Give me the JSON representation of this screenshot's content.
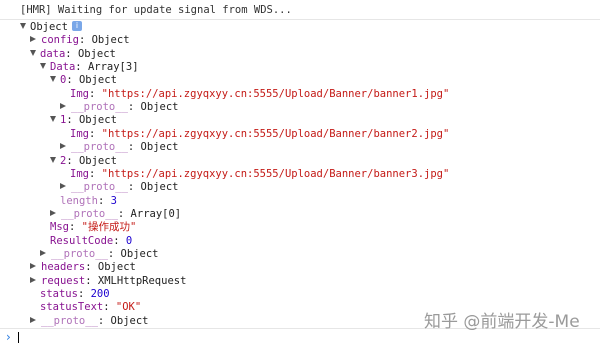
{
  "console": {
    "hmr_message": "[HMR] Waiting for update signal from WDS...",
    "rows": [
      {
        "indent": 0,
        "toggle": "down",
        "parts": [
          {
            "t": "Object",
            "c": "plain"
          }
        ],
        "info": "i"
      },
      {
        "indent": 1,
        "toggle": "right",
        "parts": [
          {
            "t": "config",
            "c": "key"
          },
          {
            "t": ": Object",
            "c": "plain"
          }
        ]
      },
      {
        "indent": 1,
        "toggle": "down",
        "parts": [
          {
            "t": "data",
            "c": "key"
          },
          {
            "t": ": Object",
            "c": "plain"
          }
        ]
      },
      {
        "indent": 2,
        "toggle": "down",
        "parts": [
          {
            "t": "Data",
            "c": "key"
          },
          {
            "t": ": Array[3]",
            "c": "plain"
          }
        ]
      },
      {
        "indent": 3,
        "toggle": "down",
        "parts": [
          {
            "t": "0",
            "c": "key"
          },
          {
            "t": ": Object",
            "c": "plain"
          }
        ]
      },
      {
        "indent": 4,
        "toggle": "none",
        "parts": [
          {
            "t": "Img",
            "c": "key"
          },
          {
            "t": ": ",
            "c": "plain"
          },
          {
            "t": "\"https://api.zgyqxyy.cn:5555/Upload/Banner/banner1.jpg\"",
            "c": "str"
          }
        ]
      },
      {
        "indent": 4,
        "toggle": "right",
        "parts": [
          {
            "t": "__proto__",
            "c": "key dim"
          },
          {
            "t": ": Object",
            "c": "plain"
          }
        ]
      },
      {
        "indent": 3,
        "toggle": "down",
        "parts": [
          {
            "t": "1",
            "c": "key"
          },
          {
            "t": ": Object",
            "c": "plain"
          }
        ]
      },
      {
        "indent": 4,
        "toggle": "none",
        "parts": [
          {
            "t": "Img",
            "c": "key"
          },
          {
            "t": ": ",
            "c": "plain"
          },
          {
            "t": "\"https://api.zgyqxyy.cn:5555/Upload/Banner/banner2.jpg\"",
            "c": "str"
          }
        ]
      },
      {
        "indent": 4,
        "toggle": "right",
        "parts": [
          {
            "t": "__proto__",
            "c": "key dim"
          },
          {
            "t": ": Object",
            "c": "plain"
          }
        ]
      },
      {
        "indent": 3,
        "toggle": "down",
        "parts": [
          {
            "t": "2",
            "c": "key"
          },
          {
            "t": ": Object",
            "c": "plain"
          }
        ]
      },
      {
        "indent": 4,
        "toggle": "none",
        "parts": [
          {
            "t": "Img",
            "c": "key"
          },
          {
            "t": ": ",
            "c": "plain"
          },
          {
            "t": "\"https://api.zgyqxyy.cn:5555/Upload/Banner/banner3.jpg\"",
            "c": "str"
          }
        ]
      },
      {
        "indent": 4,
        "toggle": "right",
        "parts": [
          {
            "t": "__proto__",
            "c": "key dim"
          },
          {
            "t": ": Object",
            "c": "plain"
          }
        ]
      },
      {
        "indent": 3,
        "toggle": "none",
        "parts": [
          {
            "t": "length",
            "c": "key dim"
          },
          {
            "t": ": ",
            "c": "plain"
          },
          {
            "t": "3",
            "c": "num"
          }
        ]
      },
      {
        "indent": 3,
        "toggle": "right",
        "parts": [
          {
            "t": "__proto__",
            "c": "key dim"
          },
          {
            "t": ": Array[0]",
            "c": "plain"
          }
        ]
      },
      {
        "indent": 2,
        "toggle": "none",
        "parts": [
          {
            "t": "Msg",
            "c": "key"
          },
          {
            "t": ": ",
            "c": "plain"
          },
          {
            "t": "\"操作成功\"",
            "c": "str"
          }
        ]
      },
      {
        "indent": 2,
        "toggle": "none",
        "parts": [
          {
            "t": "ResultCode",
            "c": "key"
          },
          {
            "t": ": ",
            "c": "plain"
          },
          {
            "t": "0",
            "c": "num"
          }
        ]
      },
      {
        "indent": 2,
        "toggle": "right",
        "parts": [
          {
            "t": "__proto__",
            "c": "key dim"
          },
          {
            "t": ": Object",
            "c": "plain"
          }
        ]
      },
      {
        "indent": 1,
        "toggle": "right",
        "parts": [
          {
            "t": "headers",
            "c": "key"
          },
          {
            "t": ": Object",
            "c": "plain"
          }
        ]
      },
      {
        "indent": 1,
        "toggle": "right",
        "parts": [
          {
            "t": "request",
            "c": "key"
          },
          {
            "t": ": XMLHttpRequest",
            "c": "plain"
          }
        ]
      },
      {
        "indent": 1,
        "toggle": "none",
        "parts": [
          {
            "t": "status",
            "c": "key"
          },
          {
            "t": ": ",
            "c": "plain"
          },
          {
            "t": "200",
            "c": "num"
          }
        ]
      },
      {
        "indent": 1,
        "toggle": "none",
        "parts": [
          {
            "t": "statusText",
            "c": "key"
          },
          {
            "t": ": ",
            "c": "plain"
          },
          {
            "t": "\"OK\"",
            "c": "str"
          }
        ]
      },
      {
        "indent": 1,
        "toggle": "right",
        "parts": [
          {
            "t": "__proto__",
            "c": "key dim"
          },
          {
            "t": ": Object",
            "c": "plain"
          }
        ]
      }
    ]
  },
  "prompt": {
    "chevron": "›"
  },
  "watermark": "知乎 @前端开发-Me",
  "colors": {
    "key": "#881391",
    "string": "#c41a16",
    "number": "#1c00cf",
    "prompt": "#2a7de1"
  }
}
